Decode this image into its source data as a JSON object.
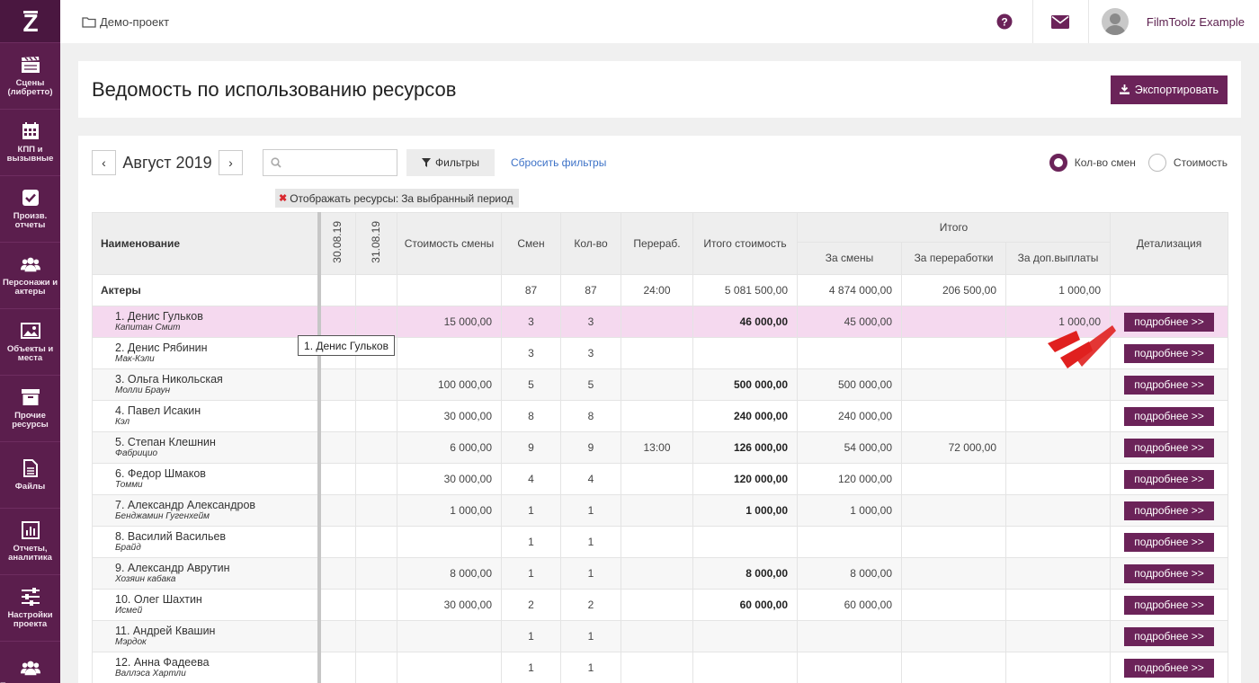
{
  "sidebar": {
    "logo": "Z",
    "items": [
      {
        "label": "Сцены\n(либретто)",
        "icon": "clapperboard-icon"
      },
      {
        "label": "КПП и\nвызывные",
        "icon": "calendar-icon"
      },
      {
        "label": "Произв.\nотчеты",
        "icon": "checkbox-icon"
      },
      {
        "label": "Персонажи и\nактеры",
        "icon": "users-icon"
      },
      {
        "label": "Объекты и\nместа",
        "icon": "image-icon"
      },
      {
        "label": "Прочие\nресурсы",
        "icon": "archive-icon"
      },
      {
        "label": "Файлы",
        "icon": "file-icon"
      },
      {
        "label": "Отчеты,\nаналитика",
        "icon": "chart-icon"
      },
      {
        "label": "Настройки\nпроекта",
        "icon": "sliders-icon"
      },
      {
        "label": "Пользователи",
        "icon": "users-icon"
      }
    ]
  },
  "topbar": {
    "breadcrumb": "Демо-проект",
    "username": "FilmToolz Example"
  },
  "page": {
    "title": "Ведомость по использованию ресурсов",
    "export_label": "Экспортировать"
  },
  "toolbar": {
    "prev": "‹",
    "next": "›",
    "month": "Август 2019",
    "search_placeholder": "",
    "filters_label": "Фильтры",
    "reset_label": "Сбросить фильтры",
    "radio_shifts": "Кол-во смен",
    "radio_cost": "Стоимость",
    "selected_mode": "Кол-во смен"
  },
  "filter_tag": {
    "label": "Отображать ресурсы:",
    "value": "За выбранный период"
  },
  "table": {
    "headers": {
      "name": "Наименование",
      "date1": "30.08.19",
      "date2": "31.08.19",
      "shift_cost": "Стоимость смены",
      "shifts": "Смен",
      "qty": "Кол-во",
      "overtime": "Перераб.",
      "total_cost": "Итого стоимость",
      "totals_group": "Итого",
      "by_shifts": "За смены",
      "by_overtime": "За переработки",
      "by_extra": "За доп.выплаты",
      "details": "Детализация"
    },
    "group": {
      "name": "Актеры",
      "shifts": "87",
      "qty": "87",
      "overtime": "24:00",
      "total_cost": "5 081 500,00",
      "by_shifts": "4 874 000,00",
      "by_overtime": "206 500,00",
      "by_extra": "1 000,00"
    },
    "more_label": "подробнее >>",
    "rows": [
      {
        "name": "1. Денис Гульков",
        "role": "Капитан Смит",
        "shift_cost": "15 000,00",
        "shifts": "3",
        "qty": "3",
        "overtime": "",
        "total_cost": "46 000,00",
        "by_shifts": "45 000,00",
        "by_overtime": "",
        "by_extra": "1 000,00"
      },
      {
        "name": "2. Денис Рябинин",
        "role": "Мак-Кэли",
        "shift_cost": "",
        "shifts": "3",
        "qty": "3",
        "overtime": "",
        "total_cost": "",
        "by_shifts": "",
        "by_overtime": "",
        "by_extra": ""
      },
      {
        "name": "3. Ольга Никольская",
        "role": "Молли Браун",
        "shift_cost": "100 000,00",
        "shifts": "5",
        "qty": "5",
        "overtime": "",
        "total_cost": "500 000,00",
        "by_shifts": "500 000,00",
        "by_overtime": "",
        "by_extra": ""
      },
      {
        "name": "4. Павел Исакин",
        "role": "Кэл",
        "shift_cost": "30 000,00",
        "shifts": "8",
        "qty": "8",
        "overtime": "",
        "total_cost": "240 000,00",
        "by_shifts": "240 000,00",
        "by_overtime": "",
        "by_extra": ""
      },
      {
        "name": "5. Степан Клешнин",
        "role": "Фабрицио",
        "shift_cost": "6 000,00",
        "shifts": "9",
        "qty": "9",
        "overtime": "13:00",
        "total_cost": "126 000,00",
        "by_shifts": "54 000,00",
        "by_overtime": "72 000,00",
        "by_extra": ""
      },
      {
        "name": "6. Федор Шмаков",
        "role": "Томми",
        "shift_cost": "30 000,00",
        "shifts": "4",
        "qty": "4",
        "overtime": "",
        "total_cost": "120 000,00",
        "by_shifts": "120 000,00",
        "by_overtime": "",
        "by_extra": ""
      },
      {
        "name": "7. Александр Александров",
        "role": "Бенджамин Гугенхейм",
        "shift_cost": "1 000,00",
        "shifts": "1",
        "qty": "1",
        "overtime": "",
        "total_cost": "1 000,00",
        "by_shifts": "1 000,00",
        "by_overtime": "",
        "by_extra": ""
      },
      {
        "name": "8. Василий Васильев",
        "role": "Брайд",
        "shift_cost": "",
        "shifts": "1",
        "qty": "1",
        "overtime": "",
        "total_cost": "",
        "by_shifts": "",
        "by_overtime": "",
        "by_extra": ""
      },
      {
        "name": "9. Александр Аврутин",
        "role": "Хозяин кабака",
        "shift_cost": "8 000,00",
        "shifts": "1",
        "qty": "1",
        "overtime": "",
        "total_cost": "8 000,00",
        "by_shifts": "8 000,00",
        "by_overtime": "",
        "by_extra": ""
      },
      {
        "name": "10. Олег Шахтин",
        "role": "Исмей",
        "shift_cost": "30 000,00",
        "shifts": "2",
        "qty": "2",
        "overtime": "",
        "total_cost": "60 000,00",
        "by_shifts": "60 000,00",
        "by_overtime": "",
        "by_extra": ""
      },
      {
        "name": "11. Андрей Квашин",
        "role": "Мэрдок",
        "shift_cost": "",
        "shifts": "1",
        "qty": "1",
        "overtime": "",
        "total_cost": "",
        "by_shifts": "",
        "by_overtime": "",
        "by_extra": ""
      },
      {
        "name": "12. Анна Фадеева",
        "role": "Валлэса Хартли",
        "shift_cost": "",
        "shifts": "1",
        "qty": "1",
        "overtime": "",
        "total_cost": "",
        "by_shifts": "",
        "by_overtime": "",
        "by_extra": ""
      }
    ]
  },
  "tooltip": "1. Денис Гульков",
  "colors": {
    "brand": "#5b1e4d",
    "button": "#6b2359",
    "highlight_row": "#f5d9ef",
    "link": "#3d72c7",
    "pointer": "#e0201f"
  }
}
